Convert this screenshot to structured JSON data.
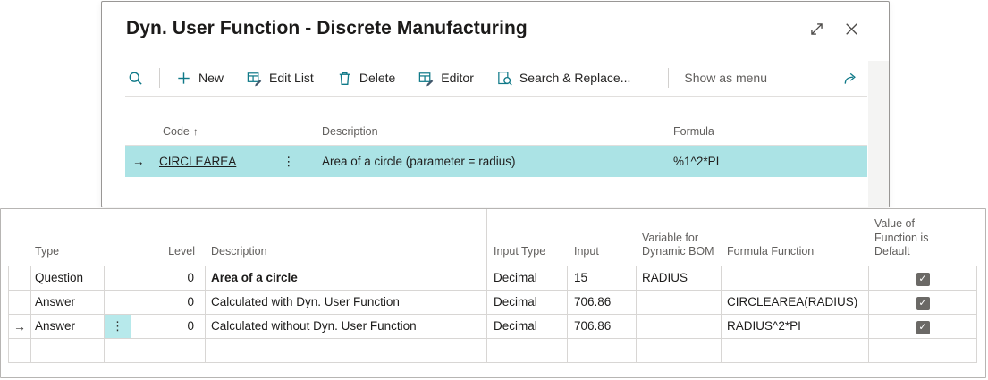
{
  "dialog": {
    "title": "Dyn. User Function - Discrete Manufacturing",
    "toolbar": {
      "actions": [
        {
          "label": "New"
        },
        {
          "label": "Edit List"
        },
        {
          "label": "Delete"
        },
        {
          "label": "Editor"
        },
        {
          "label": "Search & Replace..."
        },
        {
          "label": "Show as menu"
        }
      ]
    },
    "grid": {
      "columns": [
        "Code",
        "Description",
        "Formula"
      ],
      "sort_indicator": "↑",
      "row": {
        "code": "CIRCLEAREA",
        "description": "Area of a circle (parameter = radius)",
        "formula": "%1^2*PI"
      }
    }
  },
  "detail_table": {
    "columns": [
      "Type",
      "Level",
      "Description",
      "Input Type",
      "Input",
      "Variable for Dynamic BOM",
      "Formula Function",
      "Value of Function is Default"
    ],
    "rows": [
      {
        "type": "Question",
        "level": "0",
        "description": "Area of a circle",
        "input_type": "Decimal",
        "input": "15",
        "variable_for_dynamic_bom": "RADIUS",
        "formula_function": "",
        "default_checked": true
      },
      {
        "type": "Answer",
        "level": "0",
        "description": "Calculated with Dyn. User Function",
        "input_type": "Decimal",
        "input": "706.86",
        "variable_for_dynamic_bom": "",
        "formula_function": "CIRCLEAREA(RADIUS)",
        "default_checked": true
      },
      {
        "type": "Answer",
        "level": "0",
        "description": "Calculated without Dyn. User Function",
        "input_type": "Decimal",
        "input": "706.86",
        "variable_for_dynamic_bom": "",
        "formula_function": "RADIUS^2*PI",
        "default_checked": true
      },
      {
        "type": "",
        "level": "",
        "description": "",
        "input_type": "",
        "input": "",
        "variable_for_dynamic_bom": "",
        "formula_function": "",
        "default_checked": false
      }
    ]
  },
  "icons": {
    "row_selector": "→",
    "ellipsis": "⋮",
    "checkmark": "✓"
  },
  "colors": {
    "accent": "#0f7988",
    "selection": "#abe3e5",
    "link": "#07586b"
  }
}
